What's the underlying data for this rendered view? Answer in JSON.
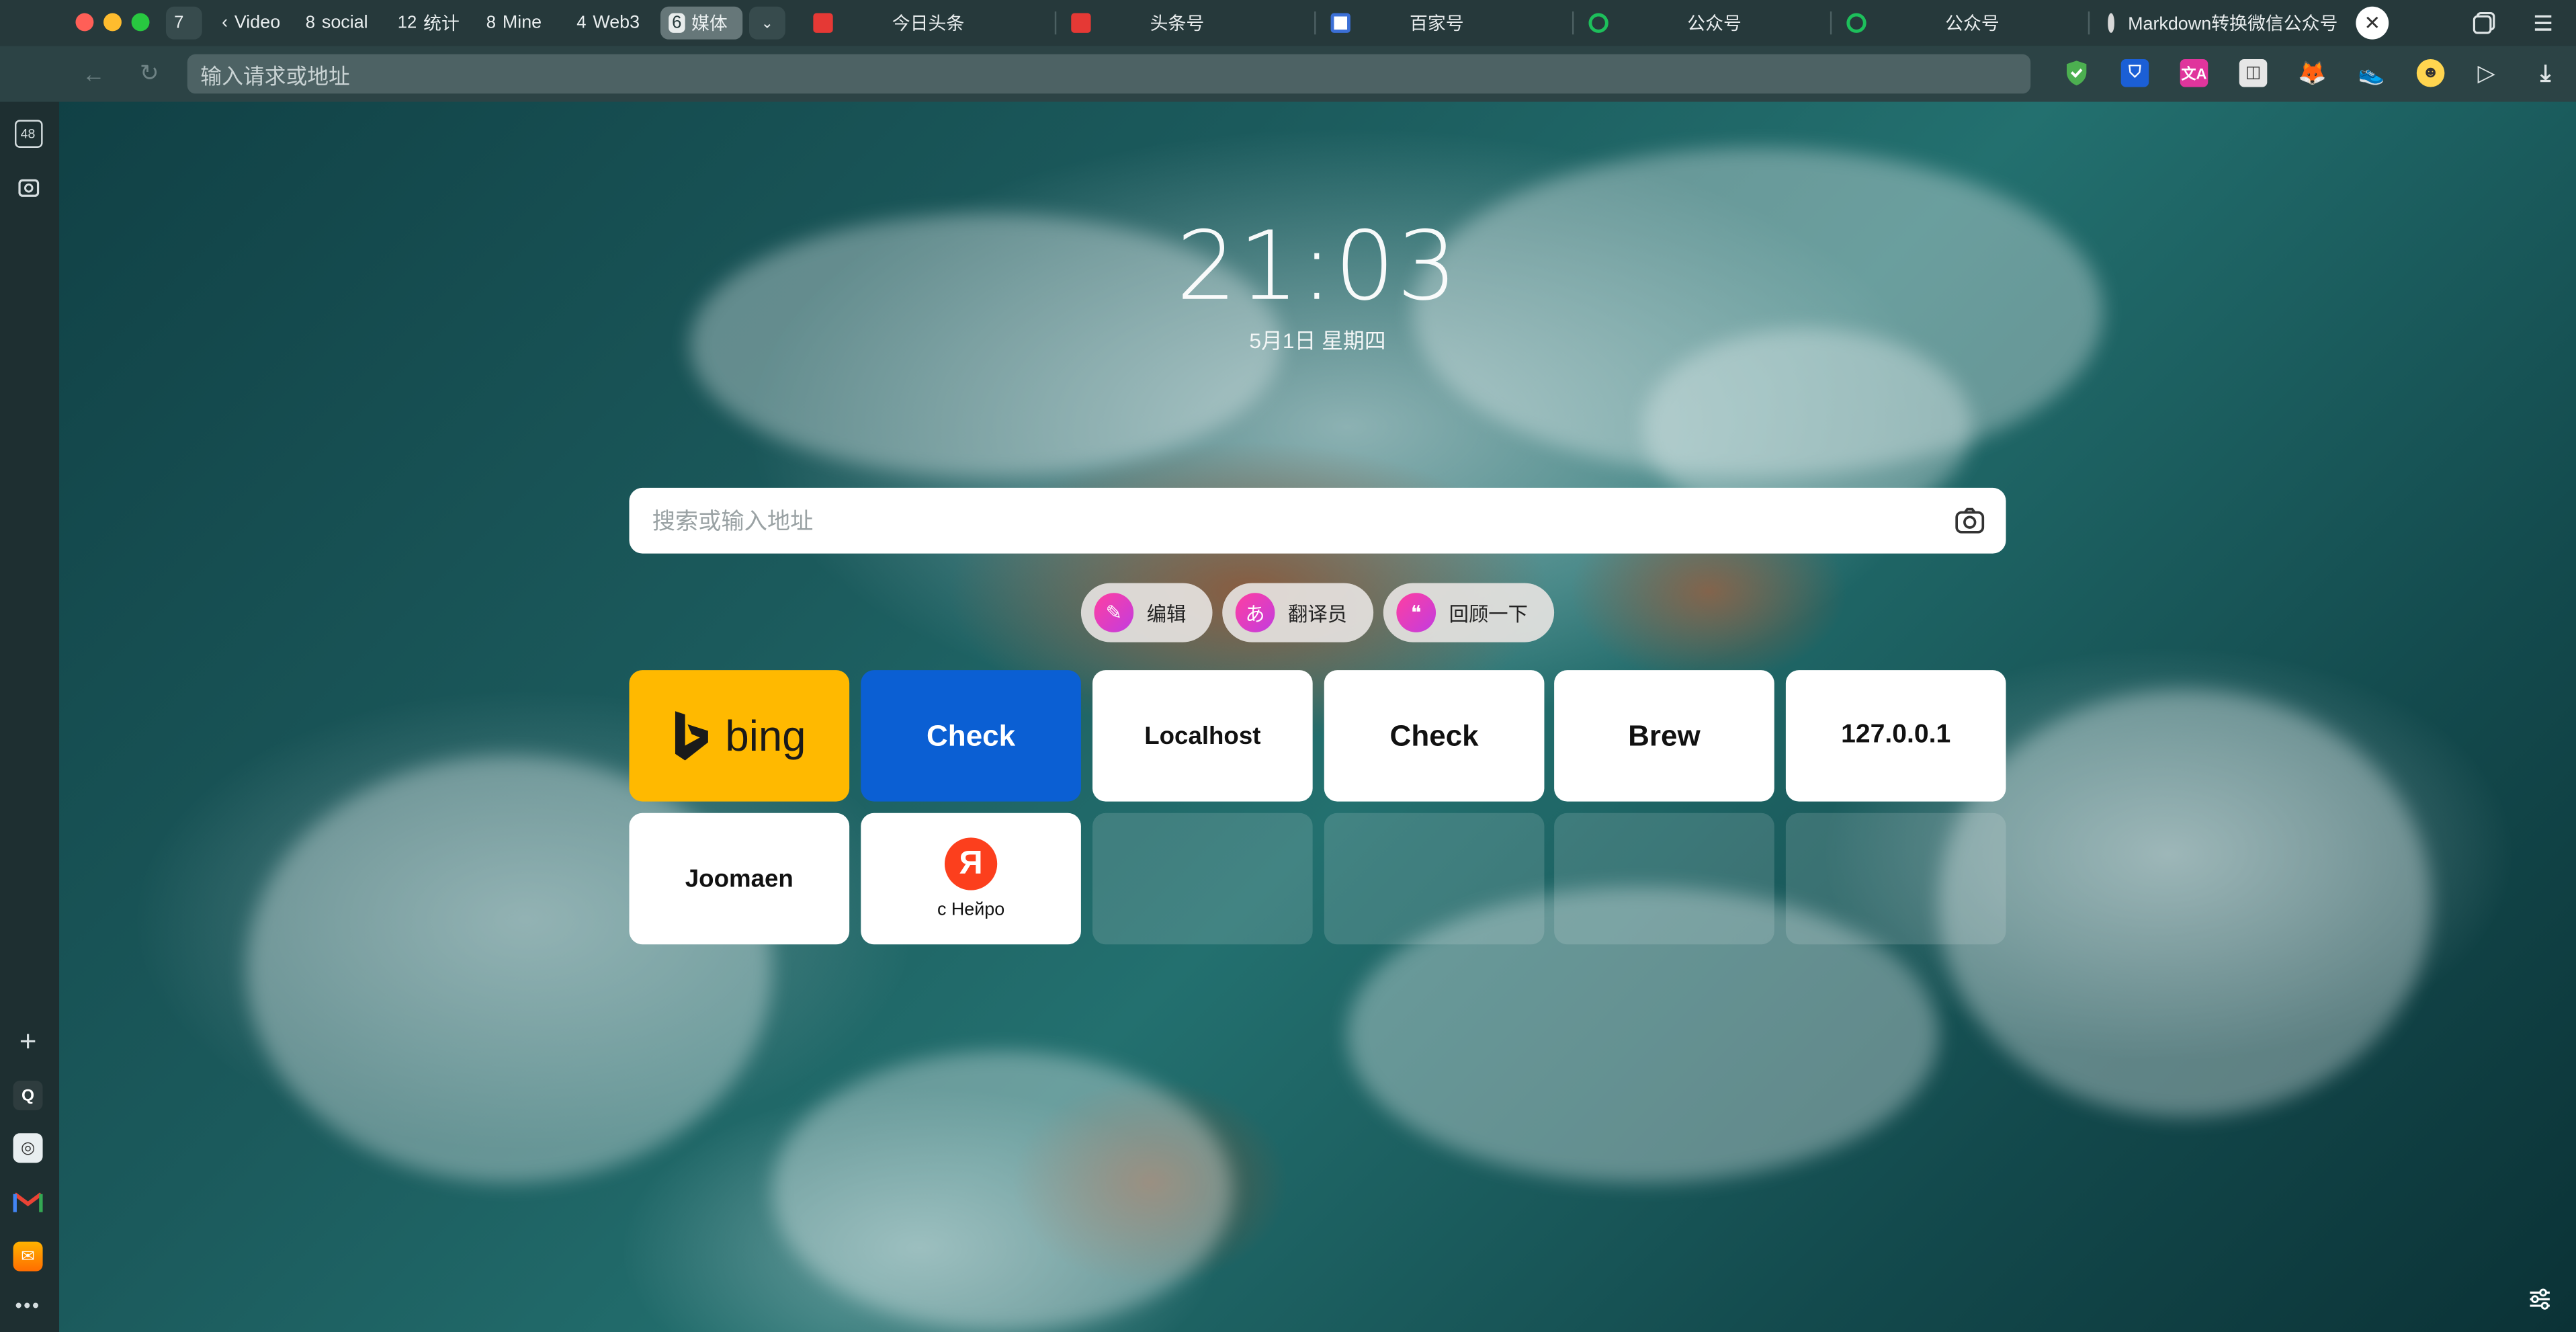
{
  "tab_groups": [
    {
      "count": "7",
      "label": ""
    },
    {
      "count": "",
      "label": "Video"
    },
    {
      "count": "8",
      "label": "social"
    },
    {
      "count": "12",
      "label": "统计"
    },
    {
      "count": "8",
      "label": "Mine"
    },
    {
      "count": "4",
      "label": "Web3"
    },
    {
      "count": "6",
      "label": "媒体"
    }
  ],
  "tabs": [
    {
      "title": "今日头条",
      "favicon_color": "#e53935"
    },
    {
      "title": "头条号",
      "favicon_color": "#e53935"
    },
    {
      "title": "百家号",
      "favicon_color": "#3b6fd6"
    },
    {
      "title": "公众号",
      "favicon_color": "#1dbf5b"
    },
    {
      "title": "公众号",
      "favicon_color": "#1dbf5b"
    },
    {
      "title": "Markdown转换微信公众号",
      "favicon_color": "#e0e0e0"
    }
  ],
  "sidebar": {
    "tab_count_badge": "48"
  },
  "address_bar": {
    "placeholder": "输入请求或地址"
  },
  "clock": {
    "time": "21:03",
    "date": "5月1日 星期四"
  },
  "search": {
    "placeholder": "搜索或输入地址"
  },
  "quick_actions": [
    {
      "label": "编辑",
      "icon": "edit-icon"
    },
    {
      "label": "翻译员",
      "icon": "translate-icon"
    },
    {
      "label": "回顾一下",
      "icon": "chat-icon"
    }
  ],
  "tiles": {
    "bing": "bing",
    "check_blue": "Check",
    "localhost": "Localhost",
    "check": "Check",
    "brew": "Brew",
    "ip": "127.0.0.1",
    "joomaen": "Joomaen",
    "yandex_letter": "Я",
    "yandex_label": "с Нейро"
  },
  "colors": {
    "bing_tile": "#FFB900",
    "check_tile": "#0B5FD3",
    "yandex_red": "#FC3F1D"
  }
}
